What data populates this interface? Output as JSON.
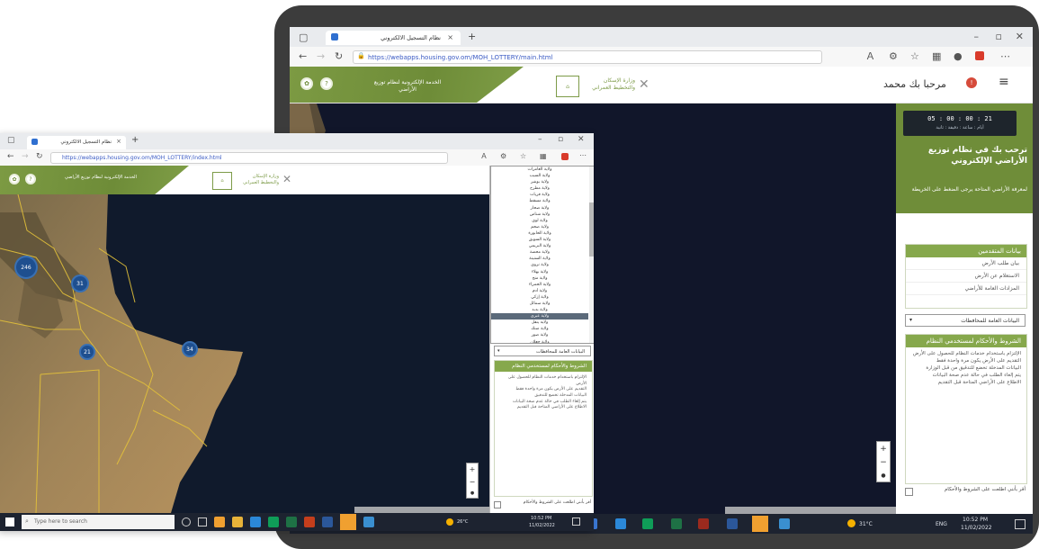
{
  "back_window": {
    "tab_title": "نظام التسجيل الالكتروني",
    "new_tab": "+",
    "url": "https://webapps.housing.gov.om/MOH_LOTTERY/main.html",
    "greeting": "مرحبا بك محمد",
    "header_wedge_text": "الخدمة الإلكترونية لنظام توزيع الأراضي",
    "logo_text": "وزارة الإسكان والتخطيط العمراني",
    "sidebar": {
      "countdown": "05 : 00 : 00 : 21",
      "countdown_units": "أيام : ساعة : دقيقة : ثانية",
      "welcome_title": "ترحب بك في نظام توزيع الأراضي الإلكتروني",
      "welcome_subtitle": "لمعرفة الأراضي المتاحة يرجى الضغط على الخريطة",
      "services_header": "بيانات المتقدمين",
      "services": [
        "بيان طلب الأرض",
        "الاستعلام عن الأرض",
        "المزادات العامة للأراضي"
      ],
      "dropdown_label": "البيانات العامة للمحافظات",
      "instructions_header": "الشروط والأحكام لمستخدمي النظام",
      "instructions": [
        "الإلتزام باستخدام خدمات النظام للحصول على الأرض",
        "التقديم على الأرض يكون مرة واحدة فقط",
        "البيانات المدخلة تخضع للتدقيق من قبل الوزارة",
        "يتم إلغاء الطلب في حالة عدم صحة البيانات",
        "الاطلاع على الأراضي المتاحة قبل التقديم"
      ],
      "terms_checkbox": "أقر بأنني اطلعت على الشروط والأحكام"
    },
    "taskbar": {
      "weather": "31°C",
      "time": "10:52 PM",
      "date": "11/02/2022",
      "lang": "ENG"
    }
  },
  "front_window": {
    "tab_title": "نظام التسجيل الالكتروني",
    "new_tab": "+",
    "url": "https://webapps.housing.gov.om/MOH_LOTTERY/index.html",
    "header_wedge_text": "الخدمة الإلكترونية لنظام توزيع الأراضي",
    "logo_text": "وزارة الإسكان والتخطيط العمراني",
    "clusters": [
      "246",
      "31",
      "21",
      "34"
    ],
    "dropdown_items": [
      "ولاية العامرات",
      "ولاية السيب",
      "ولاية بوشر",
      "ولاية مطرح",
      "ولاية قريات",
      "ولاية مسقط",
      "ولاية صحار",
      "ولاية شناص",
      "ولاية لوى",
      "ولاية صحم",
      "ولاية الخابورة",
      "ولاية السويق",
      "ولاية البريمي",
      "ولاية محضة",
      "ولاية السنينة",
      "ولاية نزوى",
      "ولاية بهلاء",
      "ولاية منح",
      "ولاية الحمراء",
      "ولاية أدم",
      "ولاية إزكي",
      "ولاية سمائل",
      "ولاية بدبد",
      "ولاية عبري",
      "ولاية ينقل",
      "ولاية ضنك",
      "ولاية صور",
      "ولاية جعلان",
      "ولاية الكامل والوافي",
      "ولاية مصيرة",
      "ولاية صلالة",
      "ولاية طاقة"
    ],
    "selected_index": 23,
    "dropdown_label": "البيانات العامة للمحافظات",
    "instructions_header": "الشروط والأحكام لمستخدمي النظام",
    "instructions": [
      "الإلتزام باستخدام خدمات النظام للحصول على الأرض",
      "التقديم على الأرض يكون مرة واحدة فقط",
      "البيانات المدخلة تخضع للتدقيق",
      "يتم إلغاء الطلب في حالة عدم صحة البيانات",
      "الاطلاع على الأراضي المتاحة قبل التقديم"
    ],
    "terms_checkbox": "أقر بأنني اطلعت على الشروط والأحكام",
    "taskbar": {
      "search_placeholder": "Type here to search",
      "weather": "26°C",
      "time": "10:52 PM",
      "date": "11/02/2022"
    }
  }
}
